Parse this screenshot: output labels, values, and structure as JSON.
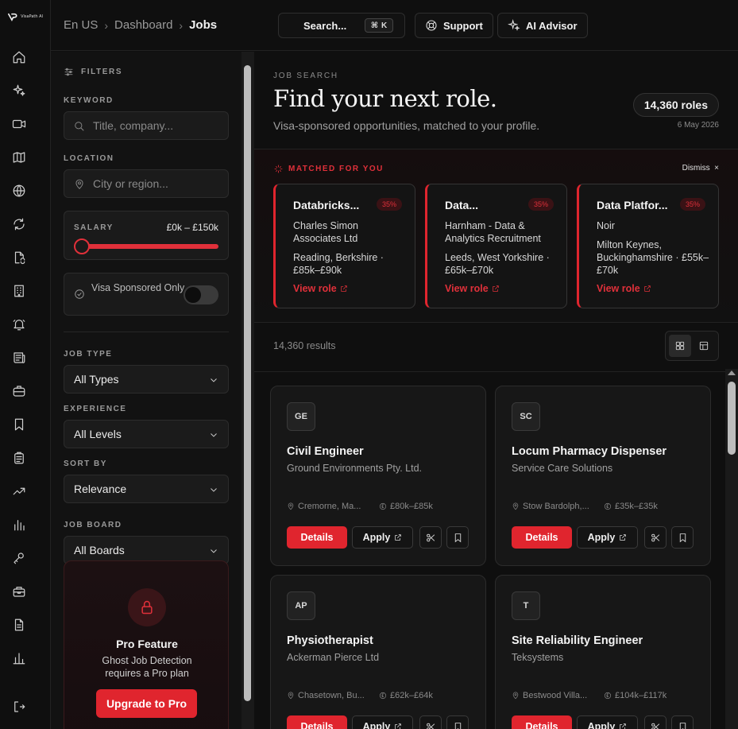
{
  "app": {
    "logo_text": "VisaPath AI",
    "accent": "#e0252e"
  },
  "rail": {
    "icons": [
      "home-icon",
      "sparkles-icon",
      "video-icon",
      "map-icon",
      "globe-icon",
      "refresh-icon",
      "document-sync-icon",
      "building-icon",
      "bell-icon",
      "newspaper-icon",
      "briefcase-icon",
      "bookmark-icon",
      "clipboard-icon",
      "trending-up-icon",
      "bar-chart-icon",
      "key-icon",
      "toolbox-icon",
      "file-text-icon",
      "bar-chart-small-icon",
      "logout-icon"
    ]
  },
  "header": {
    "breadcrumb": [
      "En US",
      "Dashboard",
      "Jobs"
    ],
    "search_label": "Search...",
    "search_shortcut": "K",
    "support_label": "Support",
    "ai_advisor_label": "AI Advisor"
  },
  "filters": {
    "heading": "FILTERS",
    "keyword_label": "KEYWORD",
    "keyword_placeholder": "Title, company...",
    "location_label": "LOCATION",
    "location_placeholder": "City or region...",
    "salary_label": "SALARY",
    "salary_range": "£0k – £150k",
    "salary_level_fraction": 0.0,
    "visa_label": "Visa Sponsored Only",
    "visa_enabled": false,
    "job_type_label": "JOB TYPE",
    "job_type_value": "All Types",
    "experience_label": "EXPERIENCE",
    "experience_value": "All Levels",
    "sort_label": "SORT BY",
    "sort_value": "Relevance",
    "board_label": "JOB BOARD",
    "board_value": "All Boards"
  },
  "pro": {
    "title": "Pro Feature",
    "subtitle": "Ghost Job Detection requires a Pro plan",
    "button": "Upgrade to Pro"
  },
  "hero": {
    "eyebrow": "JOB SEARCH",
    "title": "Find your next role.",
    "subtitle": "Visa-sponsored opportunities, matched to your profile.",
    "count": "14,360 roles",
    "date": "6 May 2026"
  },
  "matched": {
    "heading": "MATCHED FOR YOU",
    "dismiss": "Dismiss",
    "cards": [
      {
        "title": "Databricks...",
        "badge": "35%",
        "company": "Charles Simon Associates Ltd",
        "location": "Reading, Berkshire · £85k–£90k",
        "link": "View role"
      },
      {
        "title": "Data...",
        "badge": "35%",
        "company": "Harnham - Data & Analytics Recruitment",
        "location": "Leeds, West Yorkshire · £65k–£70k",
        "link": "View role"
      },
      {
        "title": "Data Platfor...",
        "badge": "35%",
        "company": "Noir",
        "location": "Milton Keynes, Buckinghamshire · £55k–£70k",
        "link": "View role"
      }
    ]
  },
  "results": {
    "count_text": "14,360 results"
  },
  "jobs": [
    {
      "initials": "GE",
      "title": "Civil Engineer",
      "company": "Ground Environments Pty. Ltd.",
      "location": "Cremorne, Ma...",
      "salary": "£80k–£85k",
      "details": "Details",
      "apply": "Apply"
    },
    {
      "initials": "SC",
      "title": "Locum Pharmacy Dispenser",
      "company": "Service Care Solutions",
      "location": "Stow Bardolph,...",
      "salary": "£35k–£35k",
      "details": "Details",
      "apply": "Apply"
    },
    {
      "initials": "AP",
      "title": "Physiotherapist",
      "company": "Ackerman Pierce Ltd",
      "location": "Chasetown, Bu...",
      "salary": "£62k–£64k",
      "details": "Details",
      "apply": "Apply"
    },
    {
      "initials": "T",
      "title": "Site Reliability Engineer",
      "company": "Teksystems",
      "location": "Bestwood Villa...",
      "salary": "£104k–£117k",
      "details": "Details",
      "apply": "Apply"
    }
  ]
}
